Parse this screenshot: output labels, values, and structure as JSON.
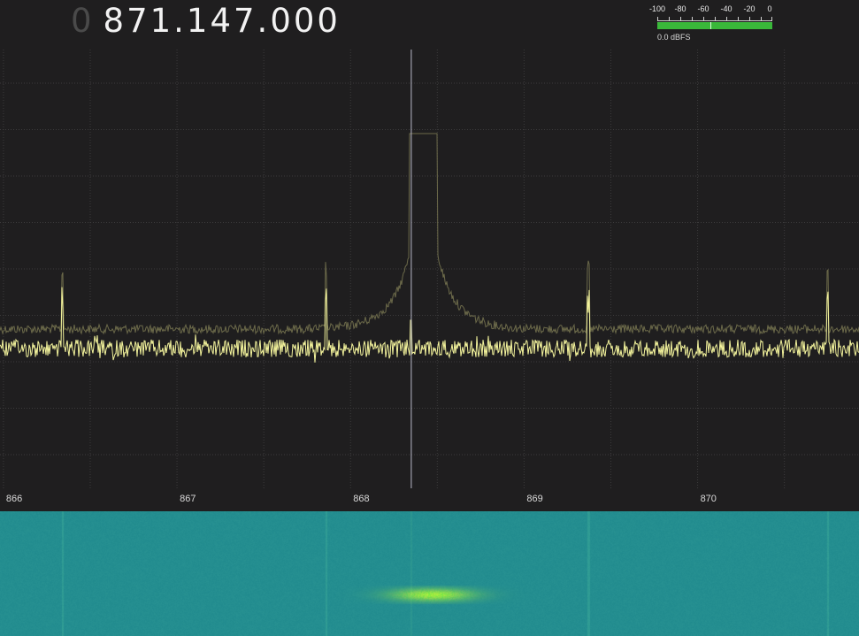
{
  "frequency": {
    "lead_digit": "0",
    "value": "871.147.000"
  },
  "smeter": {
    "scale_labels": [
      "-100",
      "-80",
      "-60",
      "-40",
      "-20",
      "0"
    ],
    "readout": "0.0 dBFS",
    "level_fraction": 1.0,
    "marker_db": -54
  },
  "spectrum": {
    "x_axis_labels": [
      "866",
      "867",
      "868",
      "869",
      "870"
    ],
    "view_mhz": [
      865.98,
      870.93
    ],
    "cursor_mhz": 868.35,
    "signal": {
      "center_mhz": 868.42,
      "peaks_mhz": [
        866.34,
        867.86,
        869.37,
        870.75
      ]
    }
  },
  "colors": {
    "background": "#1f1e1f",
    "grid": "#3c3b3c",
    "live_trace": "#f3f39c",
    "peak_trace": "#6c6a4a",
    "cursor": "#b8b8c8",
    "waterfall_base": "#248e90",
    "meter_fill": "#3ab83a"
  }
}
